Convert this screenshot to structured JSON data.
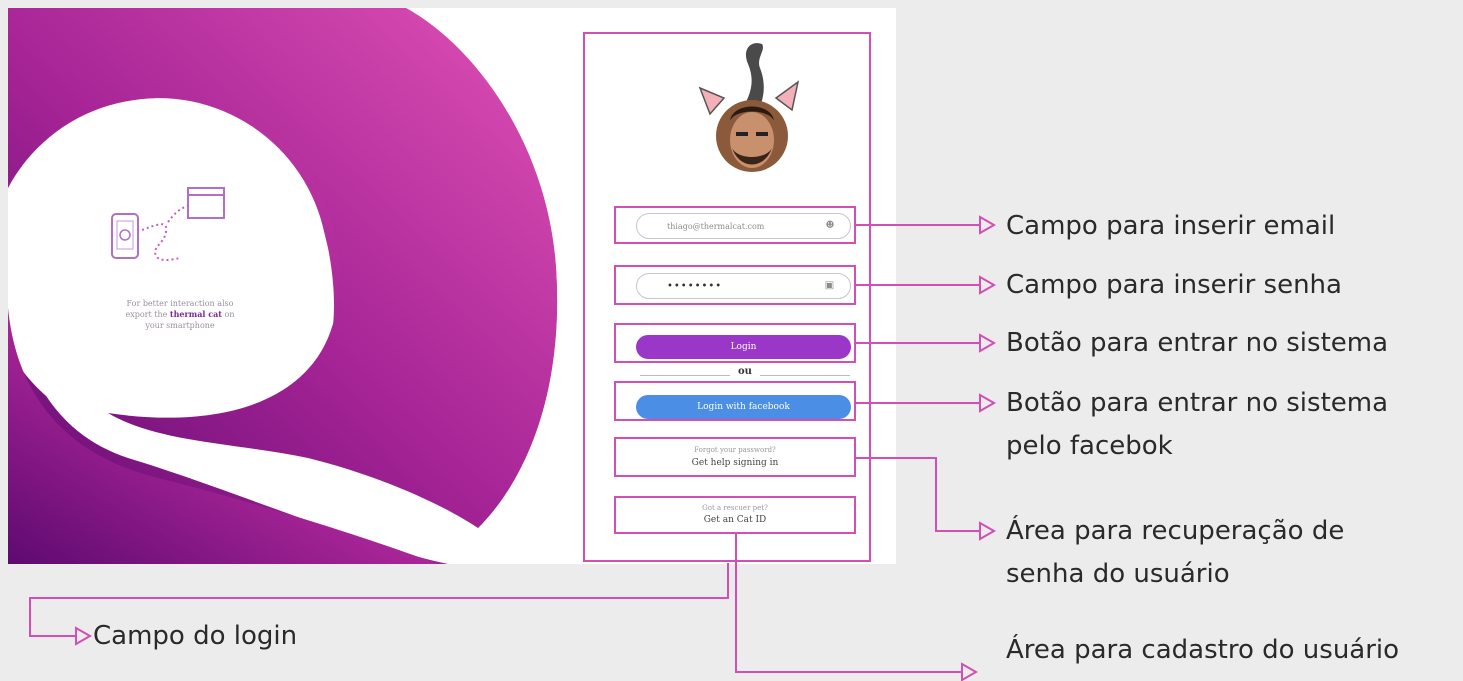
{
  "promo": {
    "line1": "For better interaction also",
    "line2_pre": "export the ",
    "line2_brand": "thermal cat",
    "line2_post": " on",
    "line3": "your smartphone"
  },
  "login": {
    "email_value": "thiago@thermalcat.com",
    "password_value": "••••••••",
    "login_label": "Login",
    "or_label": "ou",
    "facebook_label": "Login with facebook",
    "forgot_title": "Forgot your password?",
    "forgot_link": "Get help signing in",
    "register_title": "Got a rescuer pet?",
    "register_link": "Get an Cat ID"
  },
  "annotations": {
    "email": "Campo para inserir email",
    "password": "Campo para inserir senha",
    "login": "Botão para entrar no sistema",
    "facebook_line1": "Botão para entrar no sistema",
    "facebook_line2": "pelo facebok",
    "recovery_line1": "Área para recuperação de",
    "recovery_line2": "senha do usuário",
    "login_area": "Campo do login",
    "register": "Área para cadastro do usuário"
  },
  "colors": {
    "accent": "#d24fb4",
    "login_button": "#9a37c8",
    "facebook_button": "#4a8ee6",
    "swirl_start": "#e152b6",
    "swirl_end": "#6a0b78"
  }
}
